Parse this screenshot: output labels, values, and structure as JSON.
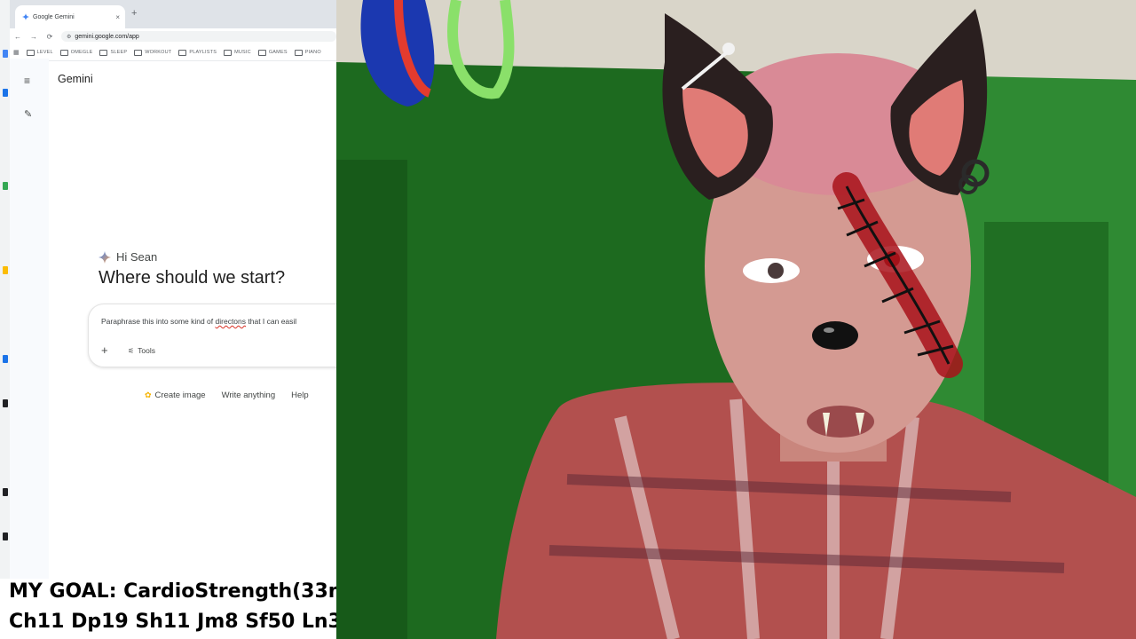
{
  "browser": {
    "tab_title": "Google Gemini",
    "tab_close": "×",
    "new_tab": "+",
    "url": "gemini.google.com/app",
    "nav": {
      "back": "←",
      "forward": "→",
      "reload": "⟳"
    },
    "bookmarks": [
      "LEVEL",
      "OMEGLE",
      "SLEEP",
      "WORKOUT",
      "PLAYLISTS",
      "MUSIC",
      "GAMES",
      "PIANO"
    ]
  },
  "gemini": {
    "app_title": "Gemini",
    "greeting": "Hi Sean",
    "headline": "Where should we start?",
    "prompt_before": "Paraphrase this into some kind of ",
    "prompt_misspelled": "directons",
    "prompt_after": " that I can easil",
    "tools_label": "Tools",
    "chips": [
      "Create image",
      "Write anything",
      "Help"
    ]
  },
  "overlay": {
    "goal_line": "MY GOAL: CardioStrength(33m",
    "stats_line": "Ch11 Dp19 Sh11 Jm8 Sf50 Ln3"
  },
  "colors": {
    "gemini_spark": "#4285f4",
    "room_green": "#1f6b1f",
    "spellcheck": "#d93025"
  },
  "icons": {
    "menu": "hamburger-icon",
    "new_chat": "edit-icon",
    "tools": "tools-icon",
    "create_image": "banana-icon"
  }
}
